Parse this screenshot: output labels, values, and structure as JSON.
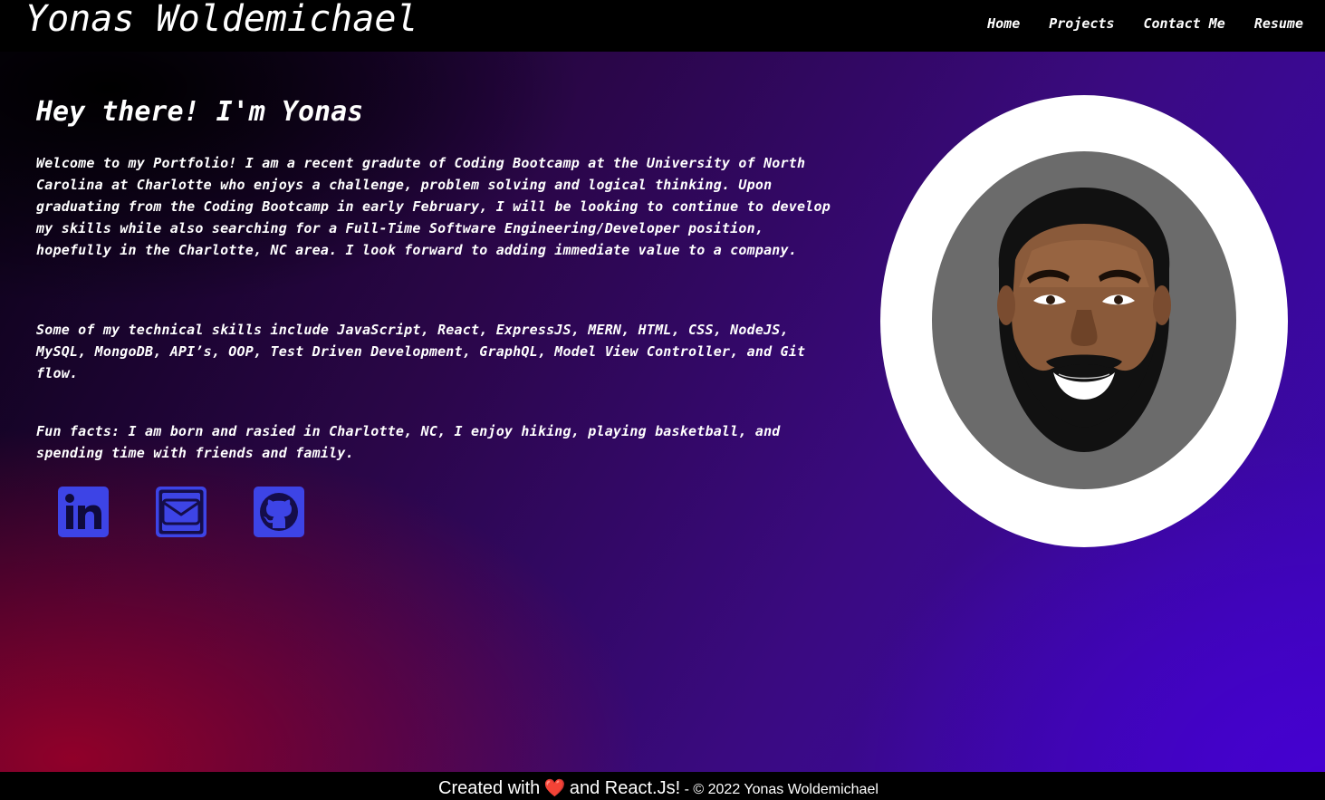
{
  "header": {
    "site_title": "Yonas Woldemichael",
    "nav": [
      {
        "label": "Home"
      },
      {
        "label": "Projects"
      },
      {
        "label": "Contact Me"
      },
      {
        "label": "Resume"
      }
    ]
  },
  "hero": {
    "heading": "Hey there! I'm Yonas",
    "paragraphs": [
      "Welcome to my Portfolio! I am a recent gradute of Coding Bootcamp at the University of North Carolina at Charlotte who enjoys a challenge, problem solving and logical thinking. Upon graduating from the Coding Bootcamp in early February, I will be looking to continue to develop my skills while also searching for a Full-Time Software Engineering/Developer position, hopefully in the Charlotte, NC area. I look forward to adding immediate value to a company.",
      "Some of my technical skills include JavaScript, React, ExpressJS, MERN, HTML, CSS, NodeJS, MySQL, MongoDB, API’s, OOP, Test Driven Development, GraphQL, Model View Controller, and Git flow.",
      "Fun facts: I am born and rasied in Charlotte, NC, I enjoy hiking, playing basketball, and spending time with friends and family."
    ],
    "socials": [
      {
        "icon": "linkedin-icon"
      },
      {
        "icon": "email-icon"
      },
      {
        "icon": "github-icon"
      }
    ],
    "avatar_icon": "avatar-illustration"
  },
  "footer": {
    "created_prefix": "Created with",
    "heart": "❤️",
    "created_suffix": "and React.Js!",
    "copyright": "- © 2022 Yonas Woldemichael"
  },
  "colors": {
    "accent": "#3d44e6",
    "header_bg": "#000000"
  }
}
